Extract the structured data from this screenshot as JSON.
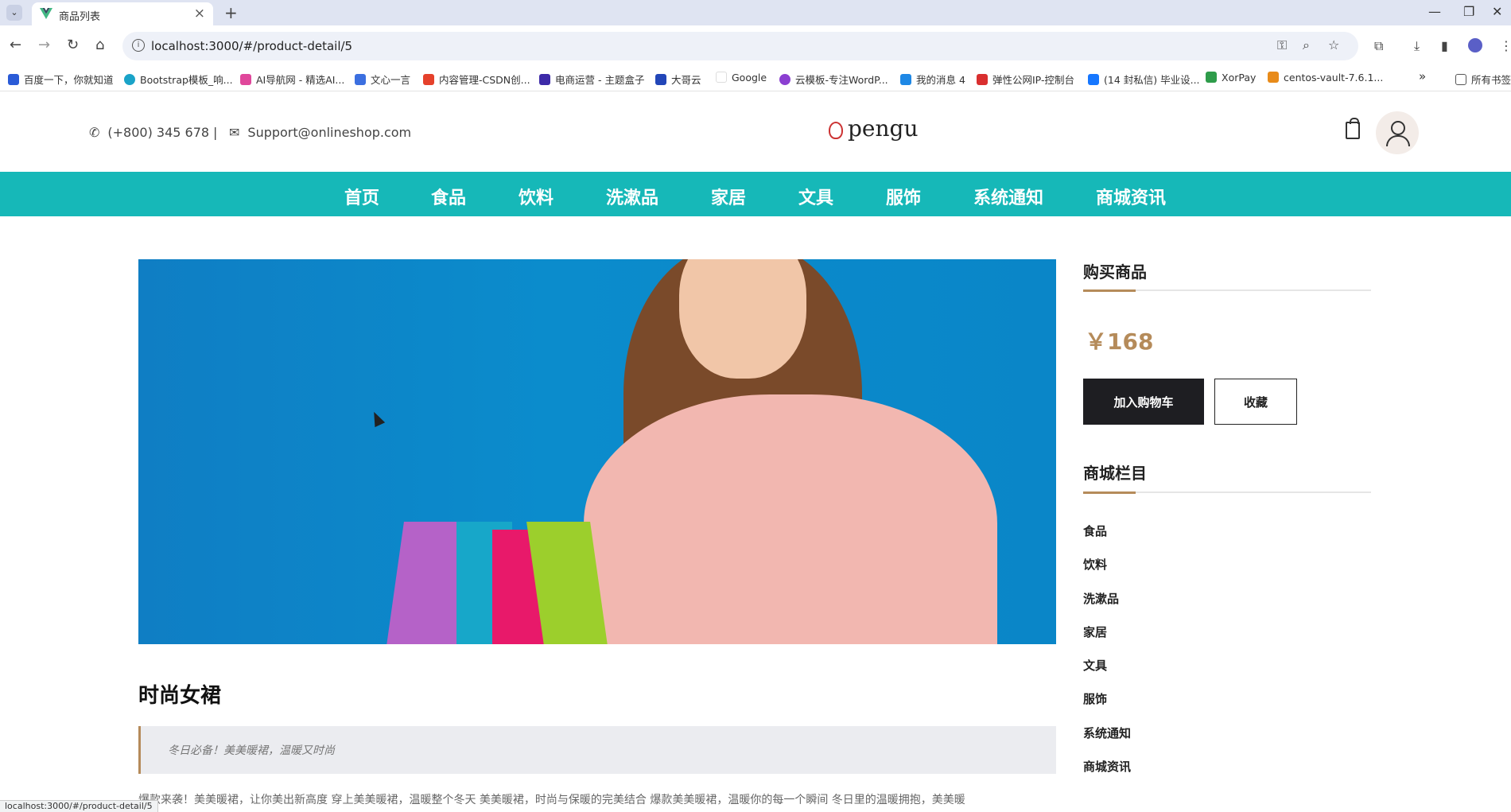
{
  "browser": {
    "tab_title": "商品列表",
    "tab_close": "×",
    "new_tab": "+",
    "url": "localhost:3000/#/product-detail/5",
    "status_url": "localhost:3000/#/product-detail/5",
    "bookmarks": [
      "百度一下，你就知道",
      "Bootstrap模板_响...",
      "AI导航网 - 精选AI...",
      "文心一言",
      "内容管理-CSDN创...",
      "电商运营 - 主题盒子",
      "大哥云",
      "Google",
      "云模板-专注WordP...",
      "我的消息 4",
      "弹性公网IP-控制台",
      "(14 封私信) 毕业设...",
      "XorPay",
      "centos-vault-7.6.1..."
    ],
    "bookmark_more": "»",
    "all_bookmarks": "所有书签"
  },
  "header": {
    "phone": "(+800) 345 678",
    "separator": "|",
    "email": "Support@onlineshop.com",
    "logo": "pengu"
  },
  "nav": [
    "首页",
    "食品",
    "饮料",
    "洗漱品",
    "家居",
    "文具",
    "服饰",
    "系统通知",
    "商城资讯"
  ],
  "product": {
    "title": "时尚女裙",
    "subtitle": "冬日必备！美美暖裙，温暖又时尚",
    "description": "爆款来袭！美美暖裙，让你美出新高度 穿上美美暖裙，温暖整个冬天 美美暖裙，时尚与保暖的完美结合 爆款美美暖裙，温暖你的每一个瞬间 冬日里的温暖拥抱，美美暖"
  },
  "sidebar": {
    "buy_title": "购买商品",
    "price": "￥168",
    "add_cart": "加入购物车",
    "favorite": "收藏",
    "categories_title": "商城栏目",
    "categories": [
      "食品",
      "饮料",
      "洗漱品",
      "家居",
      "文具",
      "服饰",
      "系统通知",
      "商城资讯"
    ]
  },
  "colors": {
    "nav_bg": "#16b8b8",
    "accent": "#b58b5a",
    "cart_button": "#1e1e22"
  }
}
